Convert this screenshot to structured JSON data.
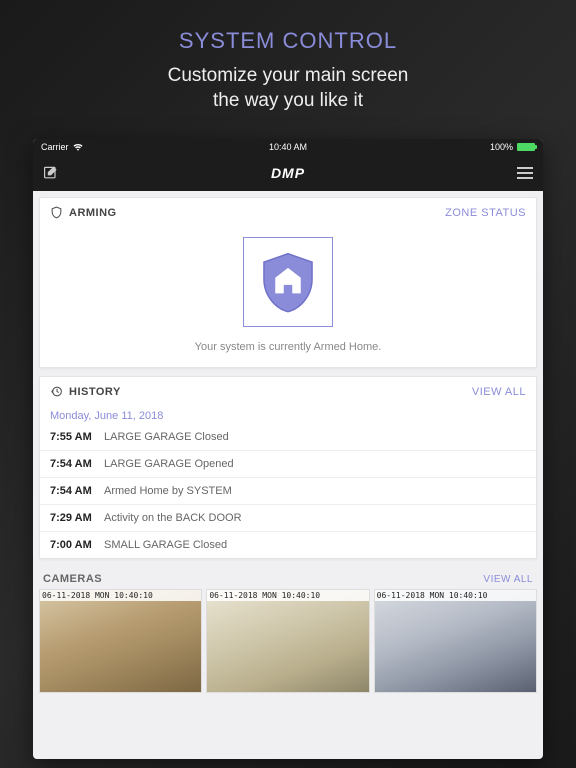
{
  "marketing": {
    "title": "SYSTEM CONTROL",
    "subtitle_line1": "Customize your main screen",
    "subtitle_line2": "the way you like it"
  },
  "statusbar": {
    "carrier": "Carrier",
    "time": "10:40 AM",
    "battery": "100%"
  },
  "navbar": {
    "logo": "DMP"
  },
  "arming": {
    "header": "ARMING",
    "link": "ZONE STATUS",
    "status": "Your system is currently Armed Home."
  },
  "history": {
    "header": "HISTORY",
    "link": "VIEW ALL",
    "date": "Monday, June 11, 2018",
    "items": [
      {
        "time": "7:55 AM",
        "text": "LARGE GARAGE Closed"
      },
      {
        "time": "7:54 AM",
        "text": "LARGE GARAGE Opened"
      },
      {
        "time": "7:54 AM",
        "text": "Armed Home by SYSTEM"
      },
      {
        "time": "7:29 AM",
        "text": "Activity on the BACK DOOR"
      },
      {
        "time": "7:00 AM",
        "text": "SMALL GARAGE Closed"
      }
    ]
  },
  "cameras": {
    "header": "CAMERAS",
    "link": "VIEW ALL",
    "timestamp": "06-11-2018 MON 10:40:10"
  }
}
